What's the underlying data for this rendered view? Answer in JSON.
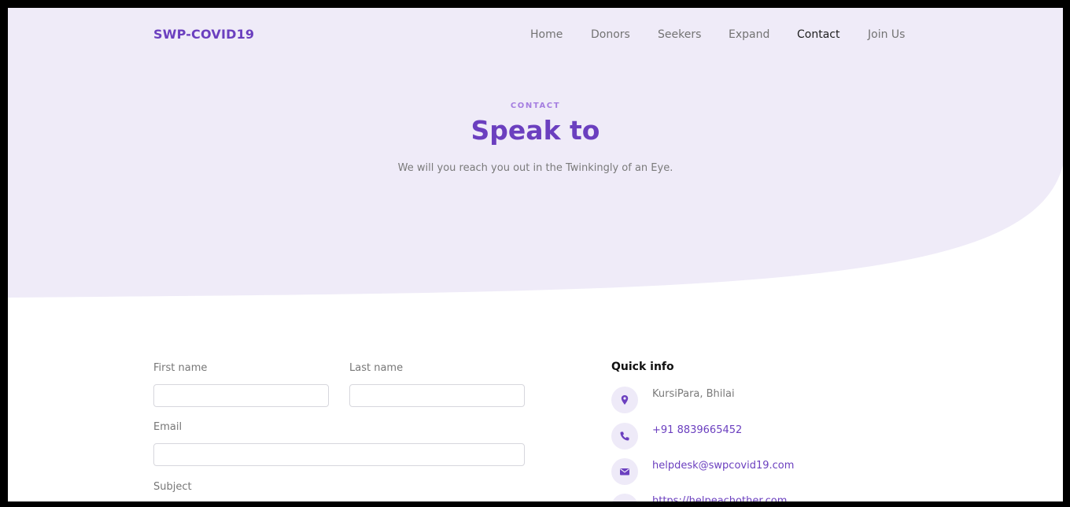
{
  "colors": {
    "accent": "#6b3fbf",
    "hero_bg": "#efebf8",
    "icon_bg": "#eeeaf8"
  },
  "nav": {
    "brand": "SWP-COVID19",
    "links": [
      {
        "label": "Home",
        "active": false
      },
      {
        "label": "Donors",
        "active": false
      },
      {
        "label": "Seekers",
        "active": false
      },
      {
        "label": "Expand",
        "active": false
      },
      {
        "label": "Contact",
        "active": true
      },
      {
        "label": "Join Us",
        "active": false
      }
    ]
  },
  "hero": {
    "eyebrow": "CONTACT",
    "title": "Speak to",
    "subtitle": "We will you reach you out in the Twinkingly of an Eye."
  },
  "form": {
    "first_name_label": "First name",
    "first_name_value": "",
    "last_name_label": "Last name",
    "last_name_value": "",
    "email_label": "Email",
    "email_value": "",
    "subject_label": "Subject"
  },
  "quick_info": {
    "title": "Quick info",
    "items": [
      {
        "icon": "map-pin-icon",
        "text": "KursiPara, Bhilai"
      },
      {
        "icon": "phone-icon",
        "text": "+91 8839665452"
      },
      {
        "icon": "envelope-icon",
        "text": "helpdesk@swpcovid19.com"
      },
      {
        "icon": "globe-icon",
        "text": "https://helpeachother.com"
      }
    ]
  }
}
